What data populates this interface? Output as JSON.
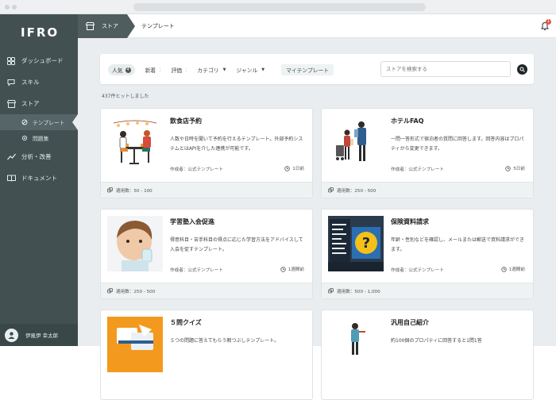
{
  "sidebar": {
    "logo": "IFRO",
    "items": [
      {
        "label": "ダッシュボード",
        "icon": "dashboard-icon"
      },
      {
        "label": "スキル",
        "icon": "chat-bubble-icon"
      },
      {
        "label": "ストア",
        "icon": "store-icon"
      },
      {
        "label": "分析・改善",
        "icon": "trend-line-icon"
      },
      {
        "label": "ドキュメント",
        "icon": "book-icon"
      }
    ],
    "subitems": [
      {
        "label": "テンプレート",
        "icon": "template-icon",
        "active": true
      },
      {
        "label": "問題集",
        "icon": "dot-icon",
        "active": false
      }
    ],
    "user": {
      "name": "伊風伊 幸太郎"
    }
  },
  "topbar": {
    "crumb_store": "ストア",
    "crumb_template": "テンプレート",
    "notification_count": "1"
  },
  "filters": {
    "tab_popular": "人気",
    "tab_popular_badge": "4",
    "tab_new": "新着",
    "tab_rating": "評価",
    "tab_category": "カテゴリ",
    "tab_genre": "ジャンル",
    "tab_my_templates": "マイテンプレート",
    "search_placeholder": "ストアを検索する"
  },
  "results": {
    "hits": "437件ヒットしました"
  },
  "cards": [
    {
      "title": "飲食店予約",
      "desc": "人数や日時を聞いて予約を行えるテンプレート。外部予約システムとはAPIを介した連携が可能です。",
      "author": "作成者：公式テンプレート",
      "time": "1日前",
      "usage": "適用数：50 - 100",
      "thumb": "restaurant-illustration"
    },
    {
      "title": "ホテルFAQ",
      "desc": "一問一答形式で宿泊者の質問に回答します。回答内容はプロパティから変更できます。",
      "author": "作成者：公式テンプレート",
      "time": "5日前",
      "usage": "適用数：250 - 500",
      "thumb": "hotel-illustration"
    },
    {
      "title": "学習塾入会促進",
      "desc": "得意科目・苦手科目の得点に応じた学習方法をアドバイスして入会を促すテンプレート。",
      "author": "作成者：公式テンプレート",
      "time": "1週間前",
      "usage": "適用数：250 - 500",
      "thumb": "child-photo"
    },
    {
      "title": "保険資料請求",
      "desc": "年齢・性別などを確認し、メールまたは郵送で資料請求ができます。",
      "author": "作成者：公式テンプレート",
      "time": "1週間前",
      "usage": "適用数：500 - 1,000",
      "thumb": "question-board-photo"
    },
    {
      "title": "５問クイズ",
      "desc": "５つの問題に答えてもらう暇つぶしテンプレート。",
      "author": "",
      "time": "",
      "usage": "",
      "thumb": "quiz-illustration"
    },
    {
      "title": "汎用自己紹介",
      "desc": "約100個のプロパティに回答すると1問1答",
      "author": "",
      "time": "",
      "usage": "",
      "thumb": "presenter-illustration"
    }
  ],
  "colors": {
    "sidebar": "#425052",
    "accent_orange": "#f39a1e",
    "accent_blue": "#2f5d8e",
    "page_bg": "#e9edef"
  }
}
